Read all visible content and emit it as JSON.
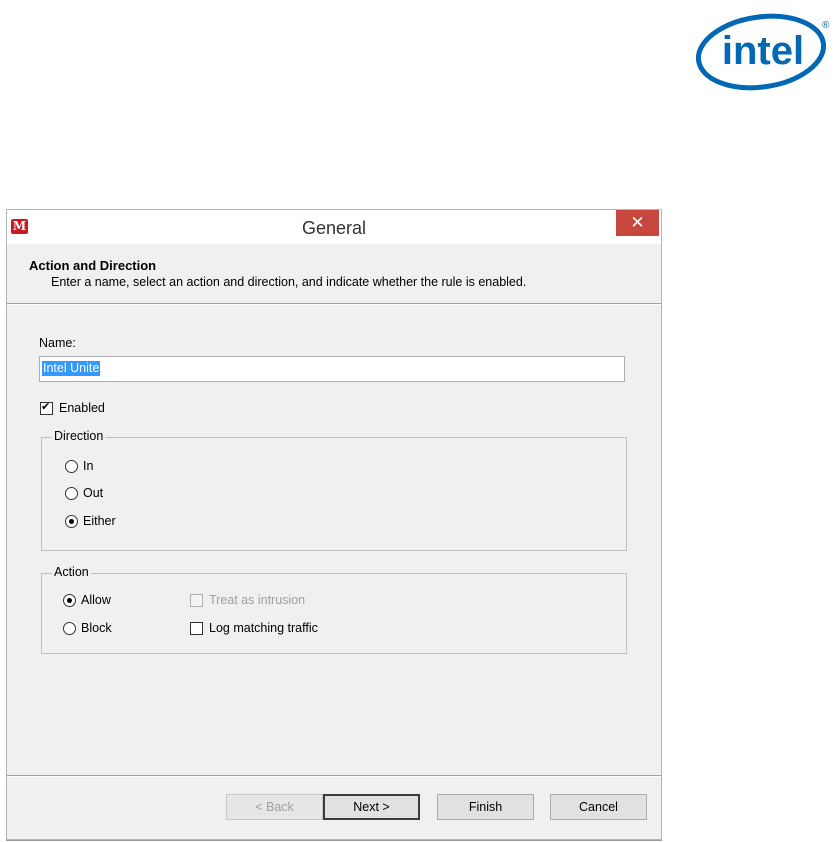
{
  "brand": {
    "logo_text": "intel",
    "registered_mark": "®",
    "color": "#0068b5"
  },
  "window": {
    "title": "General",
    "app_icon": "M",
    "close_icon": "✕"
  },
  "header": {
    "title": "Action and Direction",
    "description": "Enter a name, select an action and direction, and indicate whether the rule is enabled."
  },
  "form": {
    "name_label": "Name:",
    "name_value": "Intel Unite",
    "enabled_label": "Enabled",
    "enabled_checked": true
  },
  "direction": {
    "title": "Direction",
    "options": [
      {
        "label": "In",
        "selected": false
      },
      {
        "label": "Out",
        "selected": false
      },
      {
        "label": "Either",
        "selected": true
      }
    ]
  },
  "action": {
    "title": "Action",
    "options": [
      {
        "label": "Allow",
        "selected": true
      },
      {
        "label": "Block",
        "selected": false
      }
    ],
    "treat_intrusion_label": "Treat as intrusion",
    "log_traffic_label": "Log matching traffic"
  },
  "buttons": {
    "back": "< Back",
    "next": "Next >",
    "finish": "Finish",
    "cancel": "Cancel"
  }
}
